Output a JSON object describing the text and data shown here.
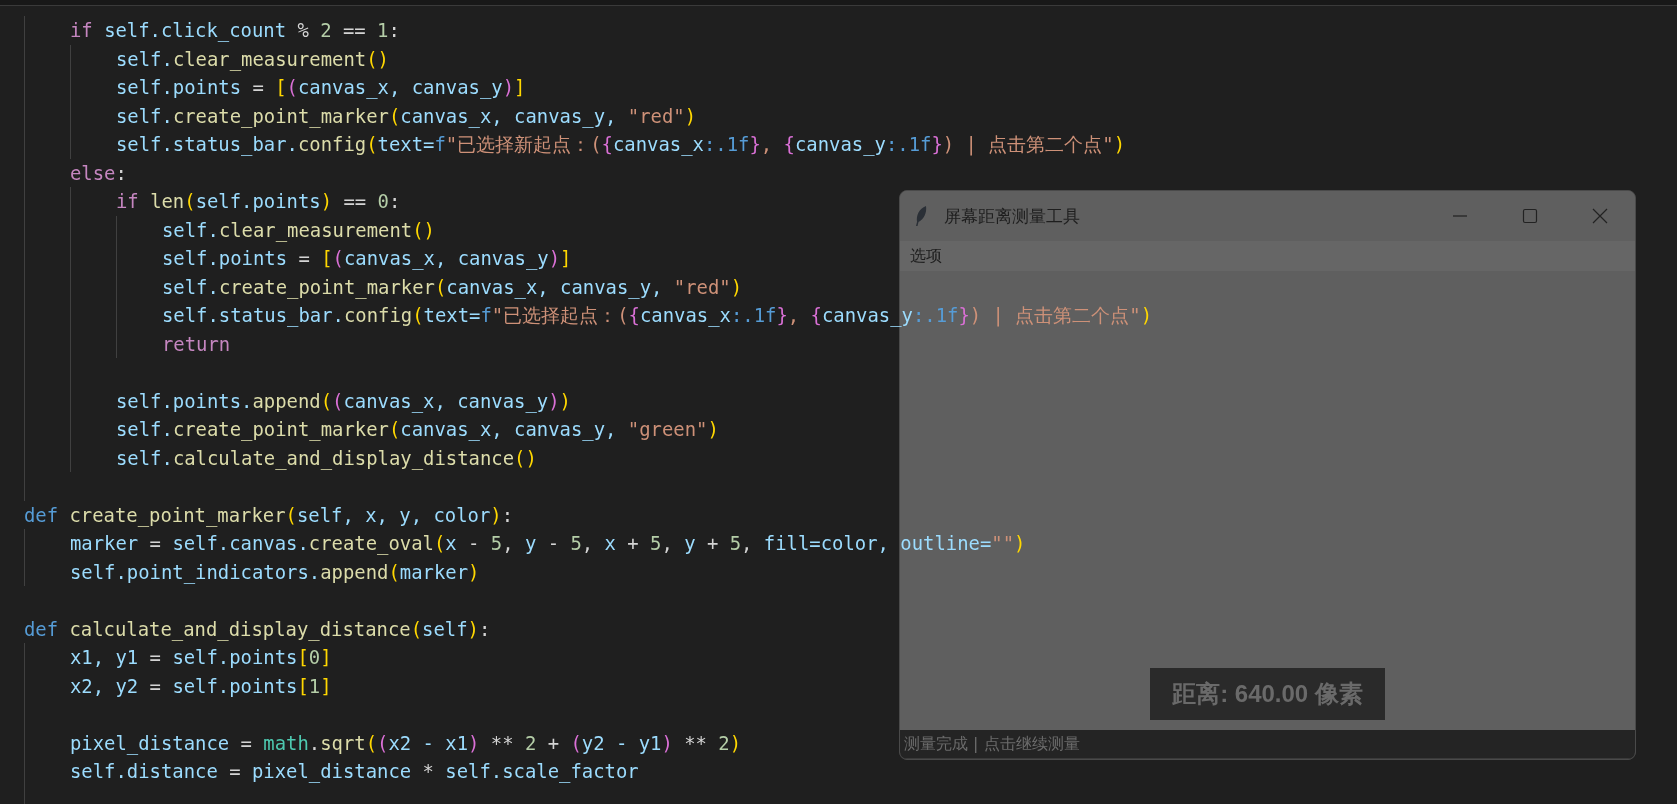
{
  "editor": {
    "lines": [
      {
        "kind": "group",
        "children": [
          {
            "kind": "code",
            "tokens": [
              {
                "kind": "kw",
                "text": "if "
              },
              {
                "kind": "var",
                "text": "self.click_count"
              },
              {
                "kind": "op",
                "text": " % "
              },
              {
                "kind": "num",
                "text": "2"
              },
              {
                "kind": "op",
                "text": " == "
              },
              {
                "kind": "num",
                "text": "1"
              },
              {
                "kind": "op",
                "text": ":"
              }
            ],
            "children": [
              {
                "kind": "code",
                "tokens": [
                  {
                    "kind": "var",
                    "text": "self."
                  },
                  {
                    "kind": "fn",
                    "text": "clear_measurement"
                  },
                  {
                    "kind": "b1",
                    "text": "()"
                  }
                ]
              },
              {
                "kind": "code",
                "tokens": [
                  {
                    "kind": "var",
                    "text": "self.points"
                  },
                  {
                    "kind": "op",
                    "text": " = "
                  },
                  {
                    "kind": "b1",
                    "text": "["
                  },
                  {
                    "kind": "b2",
                    "text": "("
                  },
                  {
                    "kind": "var",
                    "text": "canvas_x, canvas_y"
                  },
                  {
                    "kind": "b2",
                    "text": ")"
                  },
                  {
                    "kind": "b1",
                    "text": "]"
                  }
                ]
              },
              {
                "kind": "code",
                "tokens": [
                  {
                    "kind": "var",
                    "text": "self."
                  },
                  {
                    "kind": "fn",
                    "text": "create_point_marker"
                  },
                  {
                    "kind": "b1",
                    "text": "("
                  },
                  {
                    "kind": "var",
                    "text": "canvas_x, canvas_y, "
                  },
                  {
                    "kind": "str",
                    "text": "\"red\""
                  },
                  {
                    "kind": "b1",
                    "text": ")"
                  }
                ]
              },
              {
                "kind": "code",
                "tokens": [
                  {
                    "kind": "var",
                    "text": "self.status_bar."
                  },
                  {
                    "kind": "fn",
                    "text": "config"
                  },
                  {
                    "kind": "b1",
                    "text": "("
                  },
                  {
                    "kind": "var",
                    "text": "text="
                  },
                  {
                    "kind": "def",
                    "text": "f"
                  },
                  {
                    "kind": "str",
                    "text": "\"已选择新起点：("
                  },
                  {
                    "kind": "b2",
                    "text": "{"
                  },
                  {
                    "kind": "var",
                    "text": "canvas_x"
                  },
                  {
                    "kind": "def",
                    "text": ":.1f"
                  },
                  {
                    "kind": "b2",
                    "text": "}"
                  },
                  {
                    "kind": "str",
                    "text": ", "
                  },
                  {
                    "kind": "b2",
                    "text": "{"
                  },
                  {
                    "kind": "var",
                    "text": "canvas_y"
                  },
                  {
                    "kind": "def",
                    "text": ":.1f"
                  },
                  {
                    "kind": "b2",
                    "text": "}"
                  },
                  {
                    "kind": "str",
                    "text": ") | 点击第二个点\""
                  },
                  {
                    "kind": "b1",
                    "text": ")"
                  }
                ]
              }
            ]
          },
          {
            "kind": "code",
            "tokens": [
              {
                "kind": "kw",
                "text": "else"
              },
              {
                "kind": "op",
                "text": ":"
              }
            ],
            "children": [
              {
                "kind": "code",
                "tokens": [
                  {
                    "kind": "kw",
                    "text": "if "
                  },
                  {
                    "kind": "fn",
                    "text": "len"
                  },
                  {
                    "kind": "b1",
                    "text": "("
                  },
                  {
                    "kind": "var",
                    "text": "self.points"
                  },
                  {
                    "kind": "b1",
                    "text": ")"
                  },
                  {
                    "kind": "op",
                    "text": " == "
                  },
                  {
                    "kind": "num",
                    "text": "0"
                  },
                  {
                    "kind": "op",
                    "text": ":"
                  }
                ],
                "children": [
                  {
                    "kind": "code",
                    "tokens": [
                      {
                        "kind": "var",
                        "text": "self."
                      },
                      {
                        "kind": "fn",
                        "text": "clear_measurement"
                      },
                      {
                        "kind": "b1",
                        "text": "()"
                      }
                    ]
                  },
                  {
                    "kind": "code",
                    "tokens": [
                      {
                        "kind": "var",
                        "text": "self.points"
                      },
                      {
                        "kind": "op",
                        "text": " = "
                      },
                      {
                        "kind": "b1",
                        "text": "["
                      },
                      {
                        "kind": "b2",
                        "text": "("
                      },
                      {
                        "kind": "var",
                        "text": "canvas_x, canvas_y"
                      },
                      {
                        "kind": "b2",
                        "text": ")"
                      },
                      {
                        "kind": "b1",
                        "text": "]"
                      }
                    ]
                  },
                  {
                    "kind": "code",
                    "tokens": [
                      {
                        "kind": "var",
                        "text": "self."
                      },
                      {
                        "kind": "fn",
                        "text": "create_point_marker"
                      },
                      {
                        "kind": "b1",
                        "text": "("
                      },
                      {
                        "kind": "var",
                        "text": "canvas_x, canvas_y, "
                      },
                      {
                        "kind": "str",
                        "text": "\"red\""
                      },
                      {
                        "kind": "b1",
                        "text": ")"
                      }
                    ]
                  },
                  {
                    "kind": "code",
                    "tokens": [
                      {
                        "kind": "var",
                        "text": "self.status_bar."
                      },
                      {
                        "kind": "fn",
                        "text": "config"
                      },
                      {
                        "kind": "b1",
                        "text": "("
                      },
                      {
                        "kind": "var",
                        "text": "text="
                      },
                      {
                        "kind": "def",
                        "text": "f"
                      },
                      {
                        "kind": "str",
                        "text": "\"已选择起点：("
                      },
                      {
                        "kind": "b2",
                        "text": "{"
                      },
                      {
                        "kind": "var",
                        "text": "canvas_x"
                      },
                      {
                        "kind": "def",
                        "text": ":.1f"
                      },
                      {
                        "kind": "b2",
                        "text": "}"
                      },
                      {
                        "kind": "str",
                        "text": ", "
                      },
                      {
                        "kind": "b2",
                        "text": "{"
                      },
                      {
                        "kind": "var",
                        "text": "canvas_y"
                      },
                      {
                        "kind": "def",
                        "text": ":.1f"
                      },
                      {
                        "kind": "b2",
                        "text": "}"
                      },
                      {
                        "kind": "str",
                        "text": ") | 点击第二个点\""
                      },
                      {
                        "kind": "b1",
                        "text": ")"
                      }
                    ]
                  },
                  {
                    "kind": "code",
                    "tokens": [
                      {
                        "kind": "kw",
                        "text": "return"
                      }
                    ]
                  }
                ]
              },
              {
                "kind": "blank"
              },
              {
                "kind": "code",
                "tokens": [
                  {
                    "kind": "var",
                    "text": "self.points."
                  },
                  {
                    "kind": "fn",
                    "text": "append"
                  },
                  {
                    "kind": "b1",
                    "text": "("
                  },
                  {
                    "kind": "b2",
                    "text": "("
                  },
                  {
                    "kind": "var",
                    "text": "canvas_x, canvas_y"
                  },
                  {
                    "kind": "b2",
                    "text": ")"
                  },
                  {
                    "kind": "b1",
                    "text": ")"
                  }
                ]
              },
              {
                "kind": "code",
                "tokens": [
                  {
                    "kind": "var",
                    "text": "self."
                  },
                  {
                    "kind": "fn",
                    "text": "create_point_marker"
                  },
                  {
                    "kind": "b1",
                    "text": "("
                  },
                  {
                    "kind": "var",
                    "text": "canvas_x, canvas_y, "
                  },
                  {
                    "kind": "str",
                    "text": "\"green\""
                  },
                  {
                    "kind": "b1",
                    "text": ")"
                  }
                ]
              },
              {
                "kind": "code",
                "tokens": [
                  {
                    "kind": "var",
                    "text": "self."
                  },
                  {
                    "kind": "fn",
                    "text": "calculate_and_display_distance"
                  },
                  {
                    "kind": "b1",
                    "text": "()"
                  }
                ]
              }
            ]
          },
          {
            "kind": "blank"
          }
        ]
      },
      {
        "kind": "code",
        "tokens": [
          {
            "kind": "def",
            "text": "def "
          },
          {
            "kind": "fn",
            "text": "create_point_marker"
          },
          {
            "kind": "b1",
            "text": "("
          },
          {
            "kind": "var",
            "text": "self, x, y, color"
          },
          {
            "kind": "b1",
            "text": ")"
          },
          {
            "kind": "op",
            "text": ":"
          }
        ],
        "children": [
          {
            "kind": "code",
            "tokens": [
              {
                "kind": "var",
                "text": "marker"
              },
              {
                "kind": "op",
                "text": " = "
              },
              {
                "kind": "var",
                "text": "self.canvas."
              },
              {
                "kind": "fn",
                "text": "create_oval"
              },
              {
                "kind": "b1",
                "text": "("
              },
              {
                "kind": "var",
                "text": "x"
              },
              {
                "kind": "op",
                "text": " - "
              },
              {
                "kind": "num",
                "text": "5"
              },
              {
                "kind": "op",
                "text": ", "
              },
              {
                "kind": "var",
                "text": "y"
              },
              {
                "kind": "op",
                "text": " - "
              },
              {
                "kind": "num",
                "text": "5"
              },
              {
                "kind": "op",
                "text": ", "
              },
              {
                "kind": "var",
                "text": "x"
              },
              {
                "kind": "op",
                "text": " + "
              },
              {
                "kind": "num",
                "text": "5"
              },
              {
                "kind": "op",
                "text": ", "
              },
              {
                "kind": "var",
                "text": "y"
              },
              {
                "kind": "op",
                "text": " + "
              },
              {
                "kind": "num",
                "text": "5"
              },
              {
                "kind": "op",
                "text": ", "
              },
              {
                "kind": "var",
                "text": "fill=color, outline="
              },
              {
                "kind": "str",
                "text": "\"\""
              },
              {
                "kind": "b1",
                "text": ")"
              }
            ]
          },
          {
            "kind": "code",
            "tokens": [
              {
                "kind": "var",
                "text": "self.point_indicators."
              },
              {
                "kind": "fn",
                "text": "append"
              },
              {
                "kind": "b1",
                "text": "("
              },
              {
                "kind": "var",
                "text": "marker"
              },
              {
                "kind": "b1",
                "text": ")"
              }
            ]
          }
        ]
      },
      {
        "kind": "blank"
      },
      {
        "kind": "code",
        "tokens": [
          {
            "kind": "def",
            "text": "def "
          },
          {
            "kind": "fn",
            "text": "calculate_and_display_distance"
          },
          {
            "kind": "b1",
            "text": "("
          },
          {
            "kind": "var",
            "text": "self"
          },
          {
            "kind": "b1",
            "text": ")"
          },
          {
            "kind": "op",
            "text": ":"
          }
        ],
        "children": [
          {
            "kind": "code",
            "tokens": [
              {
                "kind": "var",
                "text": "x1, y1"
              },
              {
                "kind": "op",
                "text": " = "
              },
              {
                "kind": "var",
                "text": "self.points"
              },
              {
                "kind": "b1",
                "text": "["
              },
              {
                "kind": "num",
                "text": "0"
              },
              {
                "kind": "b1",
                "text": "]"
              }
            ]
          },
          {
            "kind": "code",
            "tokens": [
              {
                "kind": "var",
                "text": "x2, y2"
              },
              {
                "kind": "op",
                "text": " = "
              },
              {
                "kind": "var",
                "text": "self.points"
              },
              {
                "kind": "b1",
                "text": "["
              },
              {
                "kind": "num",
                "text": "1"
              },
              {
                "kind": "b1",
                "text": "]"
              }
            ]
          },
          {
            "kind": "blank"
          },
          {
            "kind": "code",
            "tokens": [
              {
                "kind": "var",
                "text": "pixel_distance"
              },
              {
                "kind": "op",
                "text": " = "
              },
              {
                "kind": "cls",
                "text": "math"
              },
              {
                "kind": "op",
                "text": "."
              },
              {
                "kind": "fn",
                "text": "sqrt"
              },
              {
                "kind": "b1",
                "text": "("
              },
              {
                "kind": "b2",
                "text": "("
              },
              {
                "kind": "var",
                "text": "x2 - x1"
              },
              {
                "kind": "b2",
                "text": ")"
              },
              {
                "kind": "op",
                "text": " ** "
              },
              {
                "kind": "num",
                "text": "2"
              },
              {
                "kind": "op",
                "text": " + "
              },
              {
                "kind": "b2",
                "text": "("
              },
              {
                "kind": "var",
                "text": "y2 - y1"
              },
              {
                "kind": "b2",
                "text": ")"
              },
              {
                "kind": "op",
                "text": " ** "
              },
              {
                "kind": "num",
                "text": "2"
              },
              {
                "kind": "b1",
                "text": ")"
              }
            ]
          },
          {
            "kind": "code",
            "tokens": [
              {
                "kind": "var",
                "text": "self.distance"
              },
              {
                "kind": "op",
                "text": " = "
              },
              {
                "kind": "var",
                "text": "pixel_distance"
              },
              {
                "kind": "op",
                "text": " * "
              },
              {
                "kind": "var",
                "text": "self.scale_factor"
              }
            ]
          },
          {
            "kind": "blank"
          }
        ]
      }
    ]
  },
  "window": {
    "title": "屏幕距离测量工具",
    "menu": [
      {
        "label": "选项"
      }
    ],
    "distance_label": "距离: 640.00 像素",
    "status_bar": "测量完成 | 点击继续测量"
  }
}
